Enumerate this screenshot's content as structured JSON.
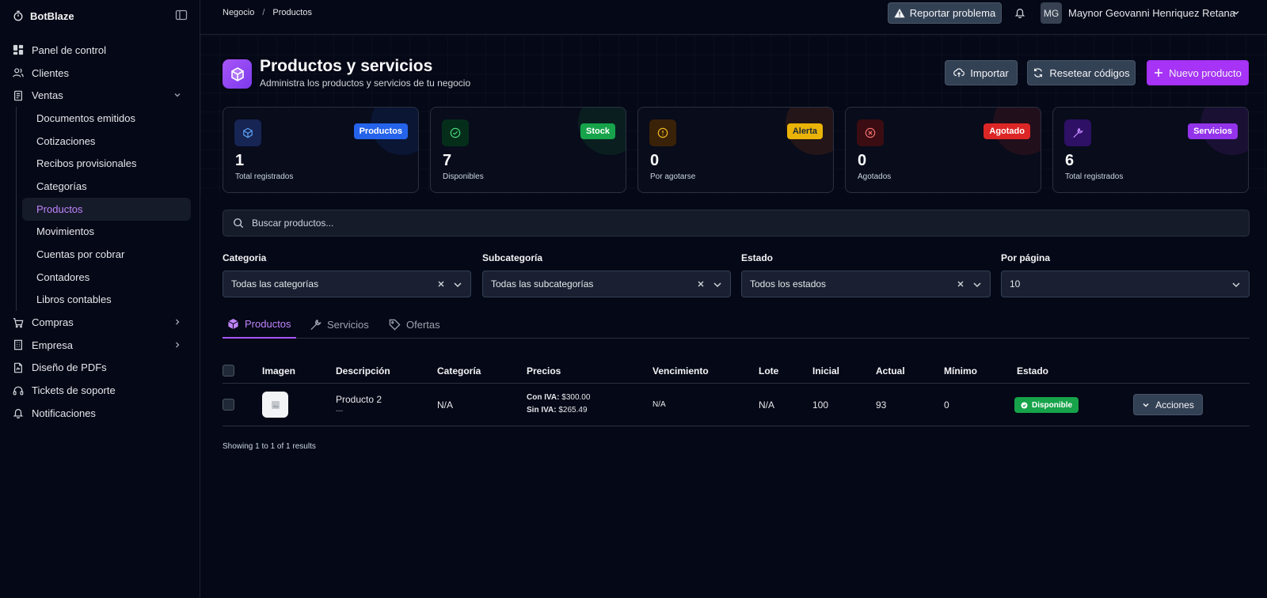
{
  "app": {
    "name": "BotBlaze"
  },
  "sidebar": {
    "items": [
      {
        "label": "Panel de control",
        "icon": "dashboard-icon"
      },
      {
        "label": "Clientes",
        "icon": "users-icon"
      },
      {
        "label": "Ventas",
        "icon": "receipt-icon",
        "expanded": true
      }
    ],
    "ventas_sub": [
      {
        "label": "Documentos emitidos"
      },
      {
        "label": "Cotizaciones"
      },
      {
        "label": "Recibos provisionales"
      },
      {
        "label": "Categorías"
      },
      {
        "label": "Productos",
        "active": true
      },
      {
        "label": "Movimientos"
      },
      {
        "label": "Cuentas por cobrar"
      },
      {
        "label": "Contadores"
      },
      {
        "label": "Libros contables"
      }
    ],
    "bottom_items": [
      {
        "label": "Compras",
        "icon": "cart-icon",
        "has_children": true
      },
      {
        "label": "Empresa",
        "icon": "building-icon",
        "has_children": true
      },
      {
        "label": "Diseño de PDFs",
        "icon": "pdf-icon"
      },
      {
        "label": "Tickets de soporte",
        "icon": "headset-icon"
      },
      {
        "label": "Notificaciones",
        "icon": "bell-icon"
      }
    ]
  },
  "topbar": {
    "breadcrumb": [
      "Negocio",
      "Productos"
    ],
    "report_label": "Reportar problema",
    "user_initials": "MG",
    "user_name": "Maynor Geovanni Henriquez Retana"
  },
  "header": {
    "title": "Productos y servicios",
    "subtitle": "Administra los productos y servicios de tu negocio",
    "import_label": "Importar",
    "reset_label": "Resetear códigos",
    "new_label": "Nuevo producto"
  },
  "stats": [
    {
      "badge": "Productos",
      "value": "1",
      "label": "Total registrados",
      "color": "#2563eb",
      "icon": "cube-icon"
    },
    {
      "badge": "Stock",
      "value": "7",
      "label": "Disponibles",
      "color": "#16a34a",
      "icon": "check-circle-icon"
    },
    {
      "badge": "Alerta",
      "value": "0",
      "label": "Por agotarse",
      "color": "#eab308",
      "icon": "alert-circle-icon"
    },
    {
      "badge": "Agotado",
      "value": "0",
      "label": "Agotados",
      "color": "#dc2626",
      "icon": "x-circle-icon"
    },
    {
      "badge": "Servicios",
      "value": "6",
      "label": "Total registrados",
      "color": "#9333ea",
      "icon": "wrench-icon"
    }
  ],
  "search": {
    "placeholder": "Buscar productos..."
  },
  "filters": {
    "categoria": {
      "label": "Categoria",
      "value": "Todas las categorías"
    },
    "subcategoria": {
      "label": "Subcategoría",
      "value": "Todas las subcategorías"
    },
    "estado": {
      "label": "Estado",
      "value": "Todos los estados"
    },
    "por_pagina": {
      "label": "Por página",
      "value": "10"
    }
  },
  "tabs": [
    {
      "label": "Productos",
      "active": true,
      "icon": "cube-icon"
    },
    {
      "label": "Servicios",
      "icon": "wrench-icon"
    },
    {
      "label": "Ofertas",
      "icon": "tag-icon"
    }
  ],
  "table": {
    "headers": [
      "Imagen",
      "Descripción",
      "Categoría",
      "Precios",
      "Vencimiento",
      "Lote",
      "Inicial",
      "Actual",
      "Mínimo",
      "Estado"
    ],
    "rows": [
      {
        "description": "Producto 2",
        "sub": "---",
        "category": "N/A",
        "price_con_label": "Con IVA:",
        "price_con": "$300.00",
        "price_sin_label": "Sin IVA:",
        "price_sin": "$265.49",
        "vencimiento": "N/A",
        "lote": "N/A",
        "inicial": "100",
        "actual": "93",
        "minimo": "0",
        "estado": "Disponible",
        "actions_label": "Acciones"
      }
    ]
  },
  "results_text": "Showing 1 to 1 of 1 results",
  "colors": {
    "accent": "#a855f7",
    "background": "#050816"
  }
}
